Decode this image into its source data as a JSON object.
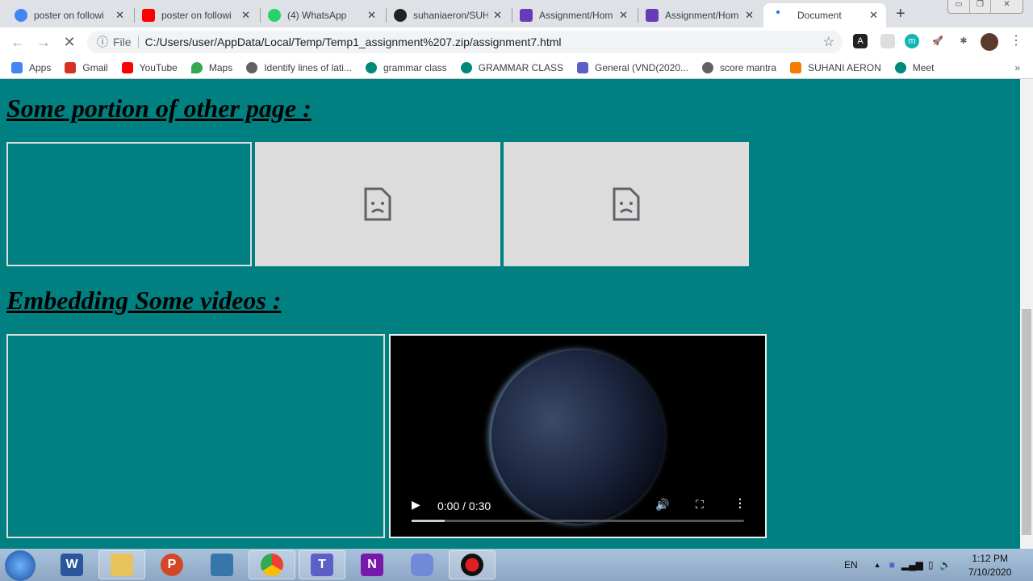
{
  "tabs": [
    {
      "label": "poster on followi",
      "icon": "google-icon",
      "color": "#4285f4"
    },
    {
      "label": "poster on followi",
      "icon": "youtube-icon",
      "color": "#ff0000"
    },
    {
      "label": "(4) WhatsApp",
      "icon": "whatsapp-icon",
      "color": "#25d366"
    },
    {
      "label": "suhaniaeron/SUH",
      "icon": "github-icon",
      "color": "#222222"
    },
    {
      "label": "Assignment/Hom",
      "icon": "forms-icon",
      "color": "#673ab7"
    },
    {
      "label": "Assignment/Hom",
      "icon": "forms-icon",
      "color": "#673ab7"
    },
    {
      "label": "Document",
      "icon": "loading-icon",
      "color": "#1a73e8"
    }
  ],
  "address": {
    "scheme": "File",
    "url": "C:/Users/user/AppData/Local/Temp/Temp1_assignment%207.zip/assignment7.html"
  },
  "bookmarks": [
    {
      "label": "Apps",
      "color": "#4285f4"
    },
    {
      "label": "Gmail",
      "color": "#d93025"
    },
    {
      "label": "YouTube",
      "color": "#ff0000"
    },
    {
      "label": "Maps",
      "color": "#34a853"
    },
    {
      "label": "Identify lines of lati...",
      "color": "#5f6368"
    },
    {
      "label": "grammar class",
      "color": "#00897b"
    },
    {
      "label": "GRAMMAR CLASS",
      "color": "#00897b"
    },
    {
      "label": "General (VND(2020...",
      "color": "#5b5fc7"
    },
    {
      "label": "score mantra",
      "color": "#5f6368"
    },
    {
      "label": "SUHANI AERON",
      "color": "#f57c00"
    },
    {
      "label": "Meet",
      "color": "#00897b"
    }
  ],
  "page": {
    "heading1": "Some portion of other page :",
    "heading2": "Embedding Some videos :"
  },
  "video": {
    "time": "0:00 / 0:30",
    "progress": 0.1
  },
  "tray": {
    "lang": "EN",
    "time": "1:12 PM",
    "date": "7/10/2020"
  }
}
